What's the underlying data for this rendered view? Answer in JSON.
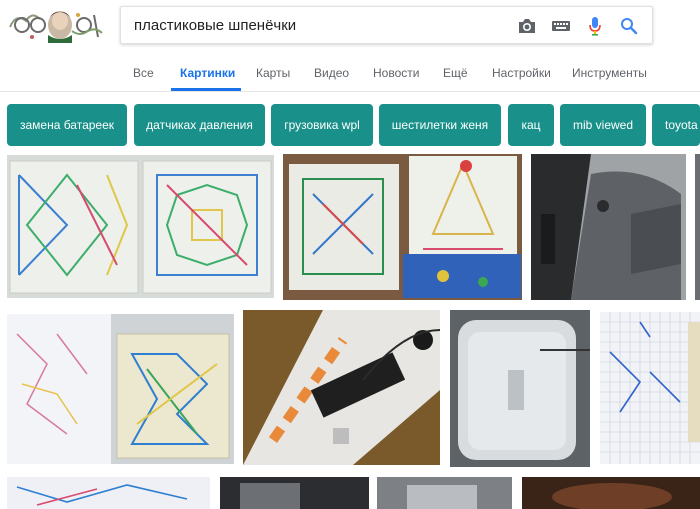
{
  "search": {
    "query": "пластиковые шпенёчки"
  },
  "icons": {
    "camera": "camera-icon",
    "keyboard": "keyboard-icon",
    "mic": "microphone-icon",
    "search": "search-icon",
    "logo": "google-doodle-logo"
  },
  "nav": {
    "tabs": [
      {
        "label": "Все"
      },
      {
        "label": "Картинки"
      },
      {
        "label": "Карты"
      },
      {
        "label": "Видео"
      },
      {
        "label": "Новости"
      },
      {
        "label": "Ещё"
      },
      {
        "label": "Настройки"
      },
      {
        "label": "Инструменты"
      }
    ],
    "active_index": 1
  },
  "chips": [
    {
      "label": "замена батареек"
    },
    {
      "label": "датчиках давления"
    },
    {
      "label": "грузовика wpl"
    },
    {
      "label": "шестилетки женя"
    },
    {
      "label": "кац"
    },
    {
      "label": "mib viewed"
    },
    {
      "label": "toyota"
    }
  ],
  "colors": {
    "accent": "#1a73e8",
    "chip_bg": "#19918a",
    "chip_text": "#ffffff",
    "tab_text": "#5f6368"
  }
}
